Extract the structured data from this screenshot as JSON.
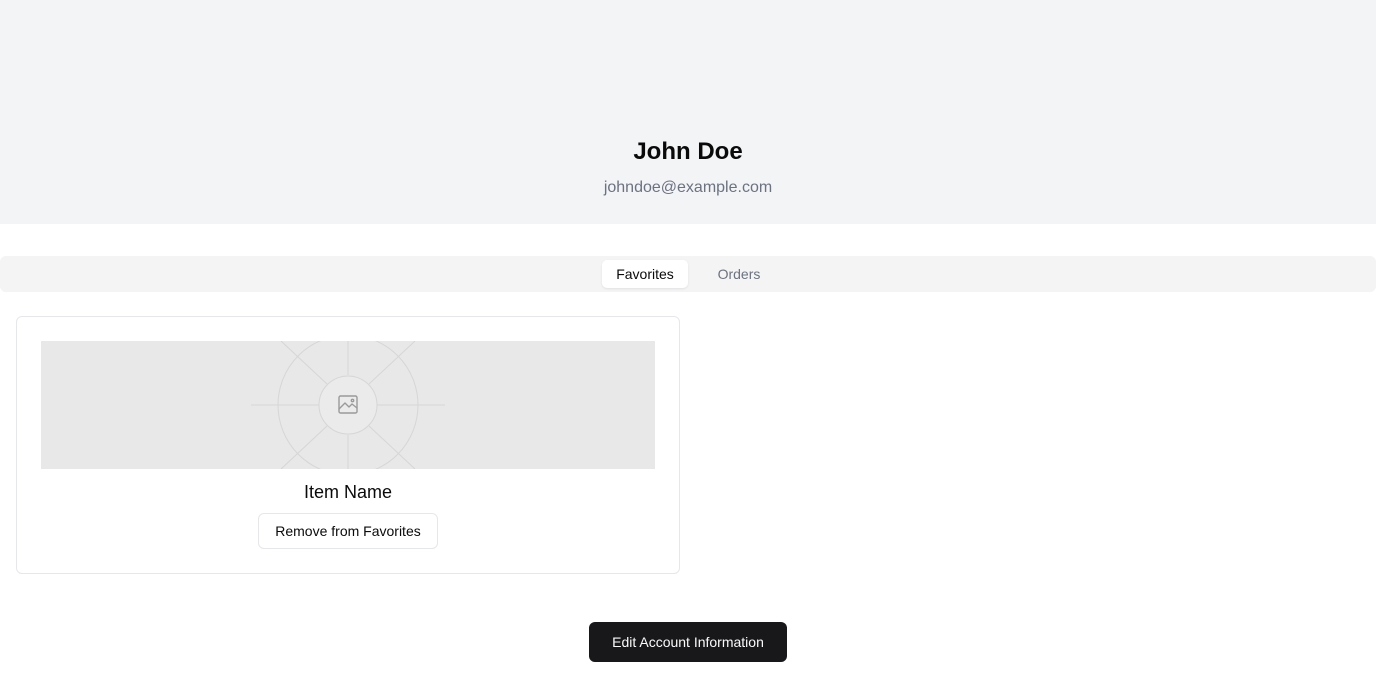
{
  "profile": {
    "name": "John Doe",
    "email": "johndoe@example.com"
  },
  "tabs": [
    {
      "label": "Favorites",
      "active": true
    },
    {
      "label": "Orders",
      "active": false
    }
  ],
  "favorites": {
    "items": [
      {
        "name": "Item Name",
        "image_icon": "image-placeholder-icon",
        "remove_label": "Remove from Favorites"
      }
    ]
  },
  "actions": {
    "edit_account_label": "Edit Account Information"
  },
  "colors": {
    "hero_background": "#f3f4f6",
    "tabs_background": "#f4f4f5",
    "primary_button": "#18181b",
    "muted_text": "#6b7280",
    "border": "#e5e7eb"
  }
}
